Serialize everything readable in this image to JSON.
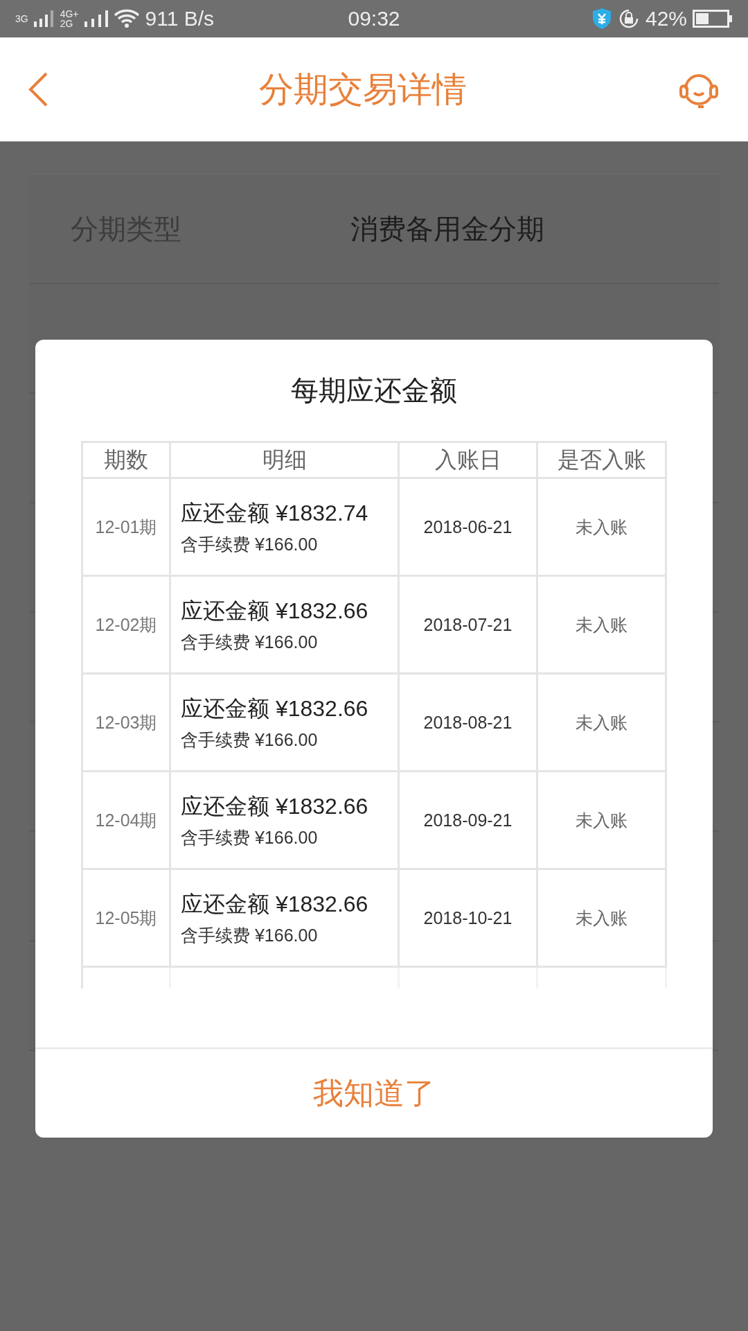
{
  "status_bar": {
    "net1": "3G",
    "net2_top": "4G+",
    "net2_bottom": "2G",
    "speed": "911 B/s",
    "time": "09:32",
    "battery": "42%"
  },
  "header": {
    "title": "分期交易详情"
  },
  "details": [
    {
      "label": "分期类型",
      "value": "消费备用金分期"
    }
  ],
  "dialog": {
    "title": "每期应还金额",
    "columns": [
      "期数",
      "明细",
      "入账日",
      "是否入账"
    ],
    "rows": [
      {
        "period": "12-01期",
        "amount": "应还金额 ¥1832.74",
        "fee": "含手续费 ¥166.00",
        "date": "2018-06-21",
        "status": "未入账"
      },
      {
        "period": "12-02期",
        "amount": "应还金额 ¥1832.66",
        "fee": "含手续费 ¥166.00",
        "date": "2018-07-21",
        "status": "未入账"
      },
      {
        "period": "12-03期",
        "amount": "应还金额 ¥1832.66",
        "fee": "含手续费 ¥166.00",
        "date": "2018-08-21",
        "status": "未入账"
      },
      {
        "period": "12-04期",
        "amount": "应还金额 ¥1832.66",
        "fee": "含手续费 ¥166.00",
        "date": "2018-09-21",
        "status": "未入账"
      },
      {
        "period": "12-05期",
        "amount": "应还金额 ¥1832.66",
        "fee": "含手续费 ¥166.00",
        "date": "2018-10-21",
        "status": "未入账"
      }
    ],
    "button": "我知道了"
  }
}
